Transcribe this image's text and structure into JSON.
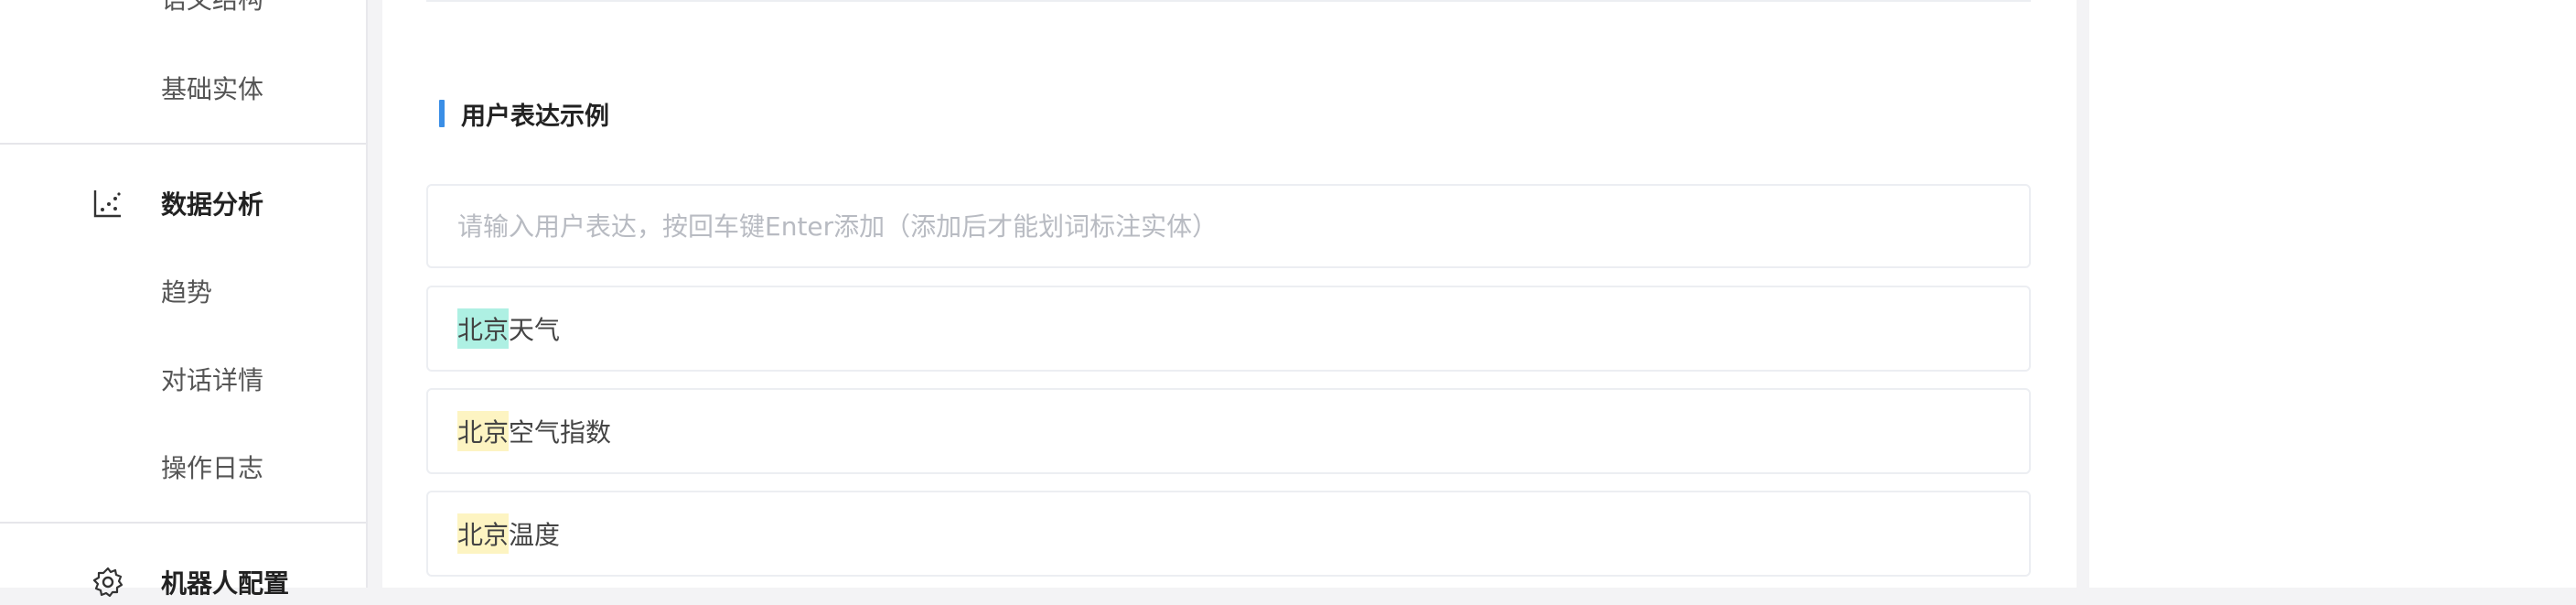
{
  "sidebar": {
    "items": [
      {
        "label": "语义结构"
      },
      {
        "label": "基础实体"
      },
      {
        "label": "数据分析",
        "icon": "chart-icon"
      },
      {
        "label": "趋势"
      },
      {
        "label": "对话详情"
      },
      {
        "label": "操作日志"
      },
      {
        "label": "机器人配置",
        "icon": "gear-icon"
      }
    ]
  },
  "main": {
    "section_title": "用户表达示例",
    "input": {
      "placeholder": "请输入用户表达，按回车键Enter添加（添加后才能划词标注实体）",
      "value": ""
    },
    "examples": [
      {
        "entity": "北京",
        "entity_color": "#aef0e3",
        "rest": "天气"
      },
      {
        "entity": "北京",
        "entity_color": "#fdf4c2",
        "rest": "空气指数"
      },
      {
        "entity": "北京",
        "entity_color": "#fdf4c2",
        "rest": "温度"
      }
    ]
  },
  "colors": {
    "accent": "#3a8ee6",
    "entity_cyan": "#aef0e3",
    "entity_yellow": "#fdf4c2"
  }
}
